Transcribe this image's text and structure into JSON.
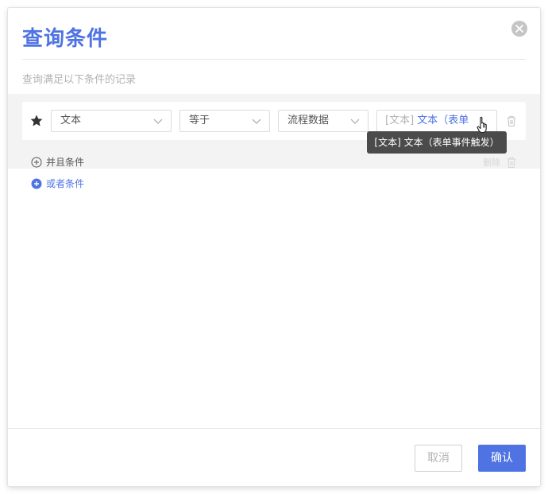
{
  "dialog": {
    "title": "查询条件",
    "subtitle": "查询满足以下条件的记录"
  },
  "condition": {
    "field": "文本",
    "operator": "等于",
    "source": "流程数据",
    "value_type": "[文本]",
    "value_text": "文本（表单"
  },
  "links": {
    "and_condition": "并且条件",
    "or_condition": "或者条件",
    "faded_delete": "删除"
  },
  "tooltip": {
    "text": "[文本] 文本（表单事件触发）"
  },
  "footer": {
    "cancel_label": "取消",
    "confirm_label": "确认"
  },
  "colors": {
    "accent": "#4f73e3",
    "tooltip_bg": "#4b4b4b",
    "group_bg": "#f3f3f3"
  },
  "icons": [
    "close-icon",
    "star-icon",
    "chevron-down-icon",
    "trash-icon",
    "plus-circle-icon",
    "hand-cursor-icon"
  ]
}
